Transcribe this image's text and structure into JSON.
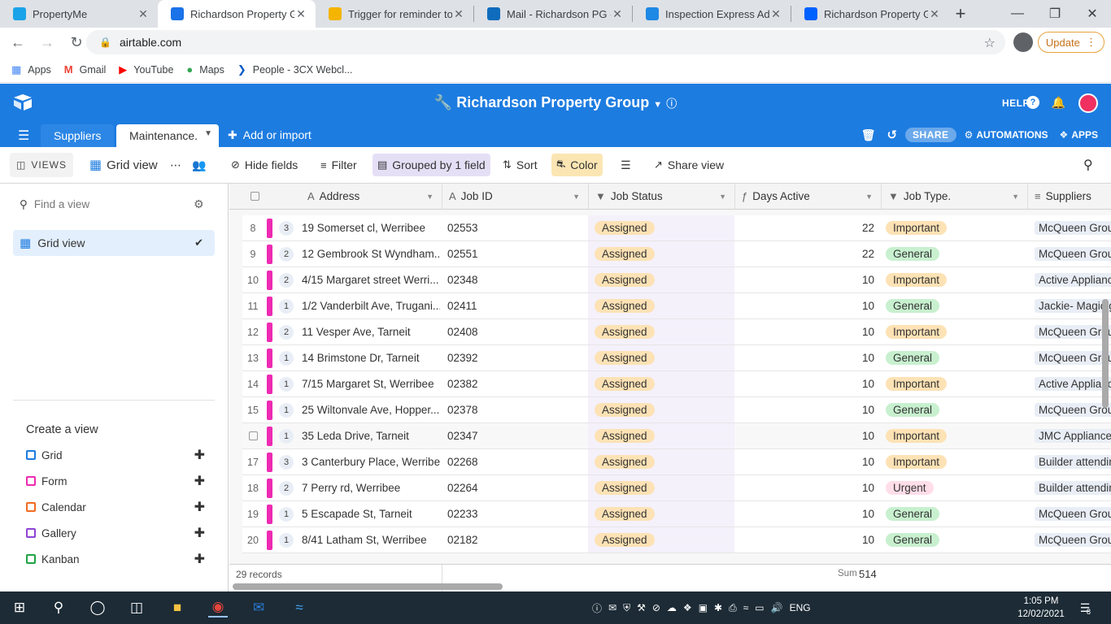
{
  "browser": {
    "tabs": [
      {
        "title": "PropertyMe",
        "color": "#1aa3e8"
      },
      {
        "title": "Richardson Property Gr",
        "color": "#1a73e8",
        "active": true
      },
      {
        "title": "Trigger for reminder to",
        "color": "#f4b400"
      },
      {
        "title": "Mail - Richardson PG -",
        "color": "#0f6cbd"
      },
      {
        "title": "Inspection Express Adm",
        "color": "#1e88e5"
      },
      {
        "title": "Richardson Property Gr",
        "color": "#0061fe"
      }
    ],
    "url": "airtable.com",
    "update_label": "Update",
    "bookmarks": [
      "Apps",
      "Gmail",
      "YouTube",
      "Maps",
      "People - 3CX Webcl..."
    ]
  },
  "header": {
    "base_title": "Richardson Property Group",
    "help": "HELP",
    "share": "SHARE",
    "automations": "AUTOMATIONS",
    "apps": "APPS"
  },
  "tables": {
    "suppliers": "Suppliers",
    "maintenance": "Maintenance.",
    "add_import": "Add or import"
  },
  "viewbar": {
    "views": "VIEWS",
    "view_name": "Grid view",
    "hide_fields": "Hide fields",
    "filter": "Filter",
    "grouped": "Grouped by 1 field",
    "sort": "Sort",
    "color": "Color",
    "share_view": "Share view"
  },
  "sidebar": {
    "find_placeholder": "Find a view",
    "active_view": "Grid view",
    "create_title": "Create a view",
    "create_items": [
      {
        "label": "Grid",
        "color": "#1d7ce0"
      },
      {
        "label": "Form",
        "color": "#ee2ab3"
      },
      {
        "label": "Calendar",
        "color": "#f26b21"
      },
      {
        "label": "Gallery",
        "color": "#8e44d6"
      },
      {
        "label": "Kanban",
        "color": "#20a346"
      }
    ]
  },
  "columns": [
    "Address",
    "Job ID",
    "Job Status",
    "Days Active",
    "Job Type.",
    "Suppliers"
  ],
  "rows": [
    {
      "num": "8",
      "count": "3",
      "address": "19 Somerset cl, Werribee",
      "job_id": "02553",
      "status": "Assigned",
      "days": "22",
      "type": "Important",
      "supplier": "McQueen Group"
    },
    {
      "num": "9",
      "count": "2",
      "address": "12 Gembrook St Wyndham...",
      "job_id": "02551",
      "status": "Assigned",
      "days": "22",
      "type": "General",
      "supplier": "McQueen Group"
    },
    {
      "num": "10",
      "count": "2",
      "address": "4/15 Margaret street Werri...",
      "job_id": "02348",
      "status": "Assigned",
      "days": "10",
      "type": "Important",
      "supplier": "Active Appliance"
    },
    {
      "num": "11",
      "count": "1",
      "address": "1/2 Vanderbilt Ave, Trugani...",
      "job_id": "02411",
      "status": "Assigned",
      "days": "10",
      "type": "General",
      "supplier": "Jackie- Magic gl"
    },
    {
      "num": "12",
      "count": "2",
      "address": "11 Vesper Ave, Tarneit",
      "job_id": "02408",
      "status": "Assigned",
      "days": "10",
      "type": "Important",
      "supplier": "McQueen Group"
    },
    {
      "num": "13",
      "count": "1",
      "address": "14 Brimstone Dr, Tarneit",
      "job_id": "02392",
      "status": "Assigned",
      "days": "10",
      "type": "General",
      "supplier": "McQueen Group"
    },
    {
      "num": "14",
      "count": "1",
      "address": "7/15 Margaret St, Werribee",
      "job_id": "02382",
      "status": "Assigned",
      "days": "10",
      "type": "Important",
      "supplier": "Active Appliance"
    },
    {
      "num": "15",
      "count": "1",
      "address": "25 Wiltonvale Ave, Hopper...",
      "job_id": "02378",
      "status": "Assigned",
      "days": "10",
      "type": "General",
      "supplier": "McQueen Group"
    },
    {
      "num": "",
      "count": "1",
      "address": "35 Leda Drive, Tarneit",
      "job_id": "02347",
      "status": "Assigned",
      "days": "10",
      "type": "Important",
      "supplier": "JMC Appliance R"
    },
    {
      "num": "17",
      "count": "3",
      "address": "3 Canterbury Place, Werribee",
      "job_id": "02268",
      "status": "Assigned",
      "days": "10",
      "type": "Important",
      "supplier": "Builder attending"
    },
    {
      "num": "18",
      "count": "2",
      "address": "7 Perry rd, Werribee",
      "job_id": "02264",
      "status": "Assigned",
      "days": "10",
      "type": "Urgent",
      "supplier": "Builder attending"
    },
    {
      "num": "19",
      "count": "1",
      "address": "5 Escapade St, Tarneit",
      "job_id": "02233",
      "status": "Assigned",
      "days": "10",
      "type": "General",
      "supplier": "McQueen Group"
    },
    {
      "num": "20",
      "count": "1",
      "address": "8/41 Latham St, Werribee",
      "job_id": "02182",
      "status": "Assigned",
      "days": "10",
      "type": "General",
      "supplier": "McQueen Group"
    }
  ],
  "pill_colors": {
    "Assigned": "#fde2b5",
    "Important": "#fde2b5",
    "General": "#c8f0cf",
    "Urgent": "#ffdde9"
  },
  "footer": {
    "records": "29 records",
    "sum_label": "Sum",
    "sum_value": "514"
  },
  "taskbar": {
    "time": "1:05 PM",
    "date": "12/02/2021",
    "lang": "ENG",
    "notifications": "8"
  }
}
